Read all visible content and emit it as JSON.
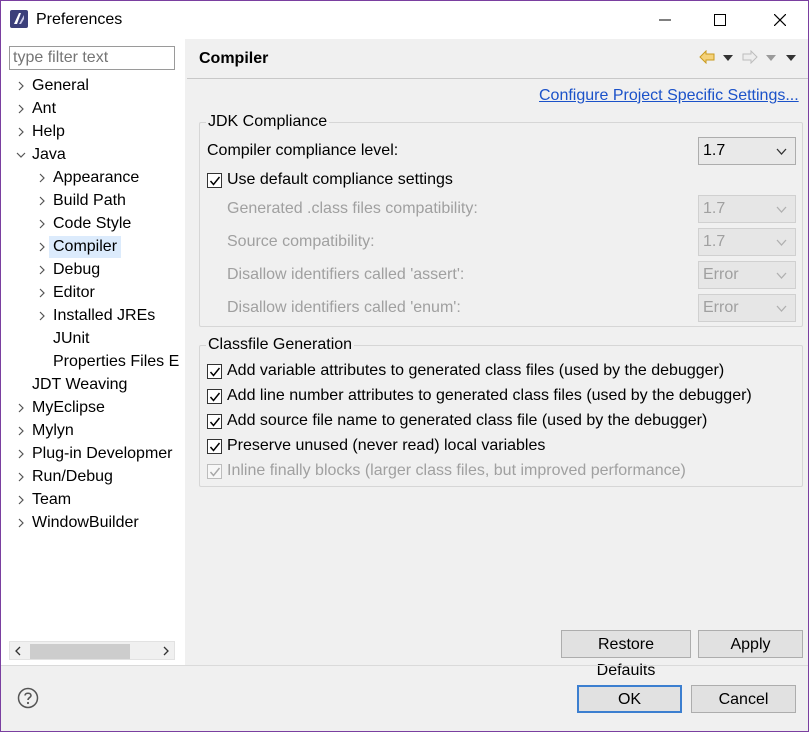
{
  "window": {
    "title": "Preferences"
  },
  "sidebar": {
    "filter_placeholder": "type filter text",
    "items": [
      {
        "label": "General",
        "level": 0,
        "arrow": "right"
      },
      {
        "label": "Ant",
        "level": 0,
        "arrow": "right"
      },
      {
        "label": "Help",
        "level": 0,
        "arrow": "right"
      },
      {
        "label": "Java",
        "level": 0,
        "arrow": "down"
      },
      {
        "label": "Appearance",
        "level": 1,
        "arrow": "right"
      },
      {
        "label": "Build Path",
        "level": 1,
        "arrow": "right"
      },
      {
        "label": "Code Style",
        "level": 1,
        "arrow": "right"
      },
      {
        "label": "Compiler",
        "level": 1,
        "arrow": "right",
        "selected": true
      },
      {
        "label": "Debug",
        "level": 1,
        "arrow": "right"
      },
      {
        "label": "Editor",
        "level": 1,
        "arrow": "right"
      },
      {
        "label": "Installed JREs",
        "level": 1,
        "arrow": "right"
      },
      {
        "label": "JUnit",
        "level": 1,
        "arrow": "none"
      },
      {
        "label": "Properties Files E",
        "level": 1,
        "arrow": "none"
      },
      {
        "label": "JDT Weaving",
        "level": 0,
        "arrow": "none"
      },
      {
        "label": "MyEclipse",
        "level": 0,
        "arrow": "right"
      },
      {
        "label": "Mylyn",
        "level": 0,
        "arrow": "right"
      },
      {
        "label": "Plug-in Developmer",
        "level": 0,
        "arrow": "right"
      },
      {
        "label": "Run/Debug",
        "level": 0,
        "arrow": "right"
      },
      {
        "label": "Team",
        "level": 0,
        "arrow": "right"
      },
      {
        "label": "WindowBuilder",
        "level": 0,
        "arrow": "right"
      }
    ]
  },
  "page": {
    "title": "Compiler",
    "configure_link": "Configure Project Specific Settings...",
    "jdk": {
      "group_title": "JDK Compliance",
      "compliance_label": "Compiler compliance level:",
      "compliance_value": "1.7",
      "use_default_label": "Use default compliance settings",
      "use_default_checked": true,
      "generated_label": "Generated .class files compatibility:",
      "generated_value": "1.7",
      "source_label": "Source compatibility:",
      "source_value": "1.7",
      "assert_label": "Disallow identifiers called 'assert':",
      "assert_value": "Error",
      "enum_label": "Disallow identifiers called 'enum':",
      "enum_value": "Error"
    },
    "classfile": {
      "group_title": "Classfile Generation",
      "options": [
        {
          "label": "Add variable attributes to generated class files (used by the debugger)",
          "checked": true,
          "disabled": false
        },
        {
          "label": "Add line number attributes to generated class files (used by the debugger)",
          "checked": true,
          "disabled": false
        },
        {
          "label": "Add source file name to generated class file (used by the debugger)",
          "checked": true,
          "disabled": false
        },
        {
          "label": "Preserve unused (never read) local variables",
          "checked": true,
          "disabled": false
        },
        {
          "label": "Inline finally blocks (larger class files, but improved performance)",
          "checked": true,
          "disabled": true
        }
      ]
    },
    "restore_defaults": "Restore Defaults",
    "apply": "Apply"
  },
  "footer": {
    "ok": "OK",
    "cancel": "Cancel"
  },
  "colors": {
    "link": "#1b52c9",
    "selection": "#dcebfc",
    "default_button_border": "#3c7fd0",
    "window_border": "#7a3fa0"
  },
  "icons": {
    "app": "eclipse-icon",
    "minimize": "minimize-icon",
    "maximize": "maximize-icon",
    "close": "close-icon",
    "back": "back-arrow-icon",
    "forward": "forward-arrow-icon",
    "help": "help-icon"
  }
}
